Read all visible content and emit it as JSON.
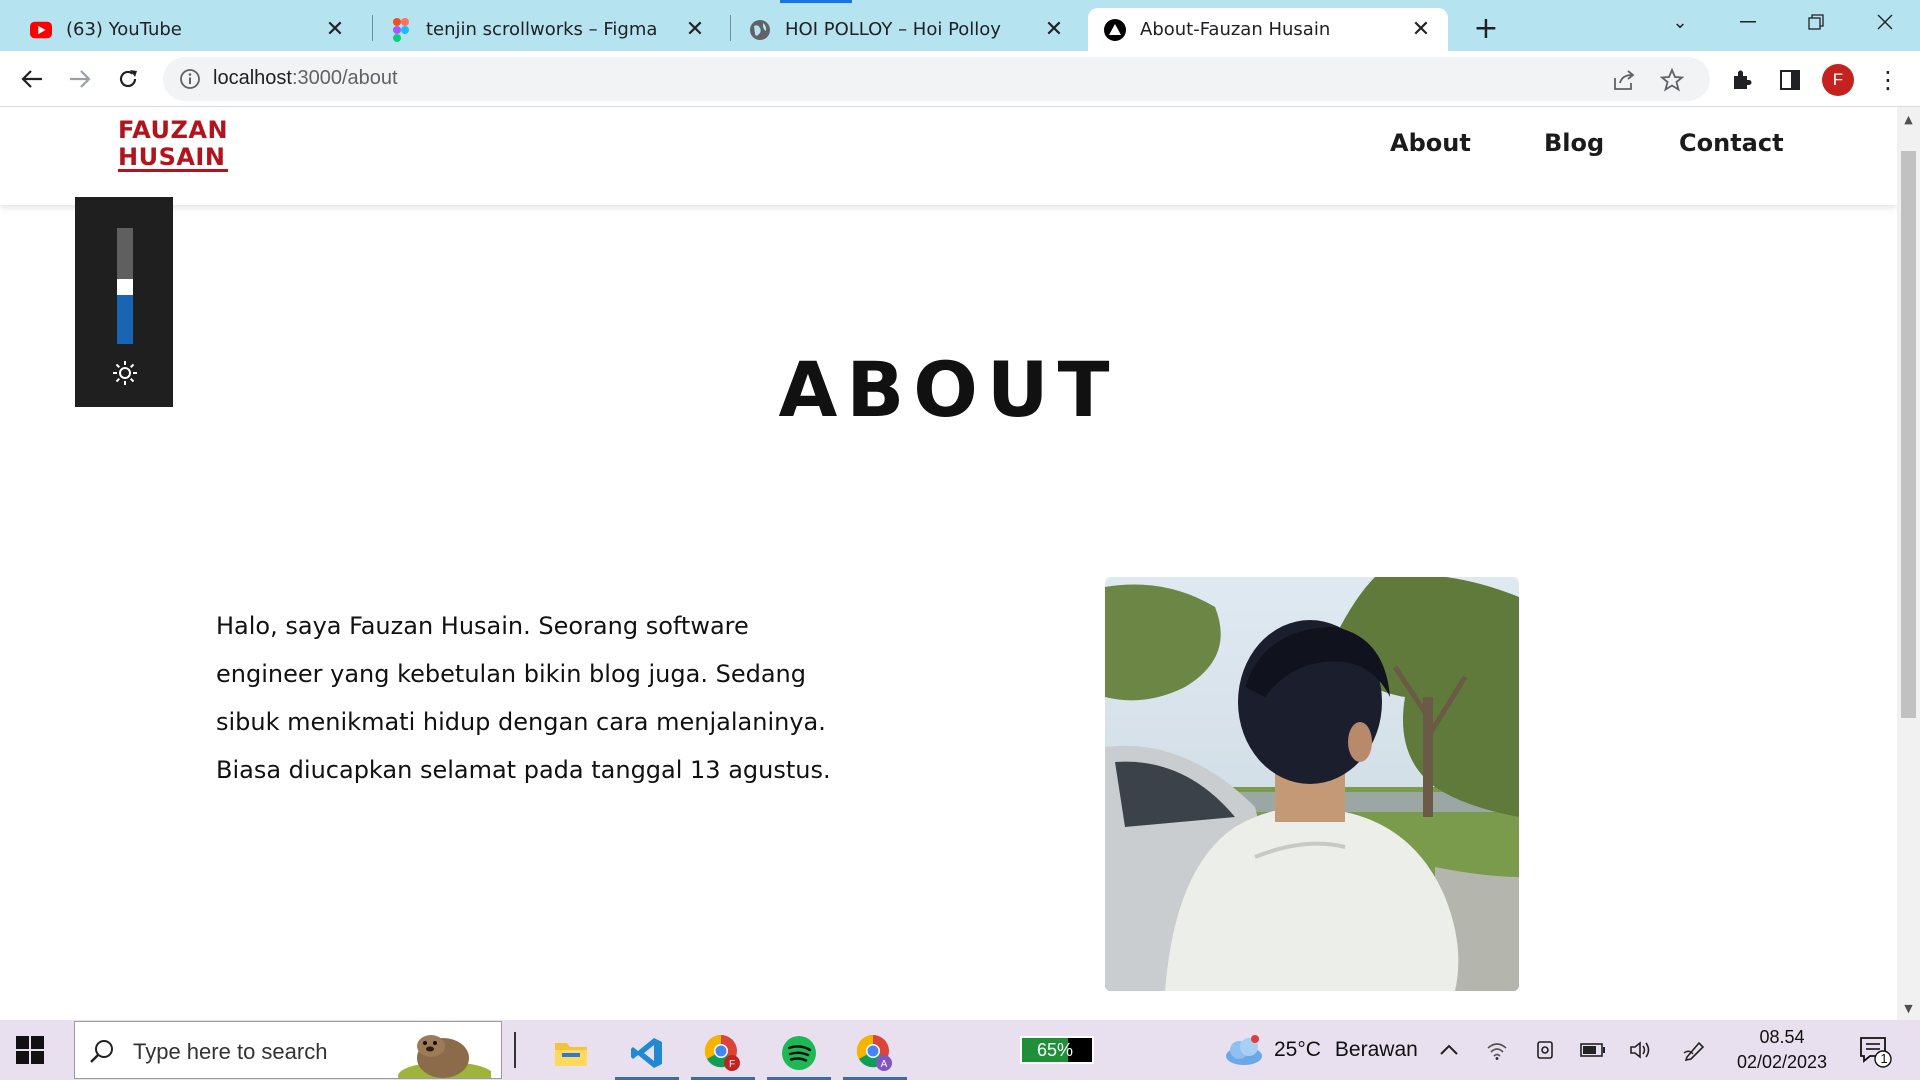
{
  "browser": {
    "tabs": [
      {
        "title": "(63) YouTube",
        "icon": "youtube-icon"
      },
      {
        "title": "tenjin scrollworks – Figma",
        "icon": "figma-icon"
      },
      {
        "title": "HOI POLLOY – Hoi Polloy",
        "icon": "globe-icon"
      },
      {
        "title": "About-Fauzan Husain",
        "icon": "triangle-logo-icon"
      }
    ],
    "url_host": "localhost",
    "url_path": ":3000/about",
    "profile_initial": "F"
  },
  "site": {
    "logo_line1": "FAUZAN",
    "logo_line2": "HUSAIN",
    "nav": [
      "About",
      "Blog",
      "Contact"
    ],
    "title": "ABOUT",
    "bio": "Halo, saya Fauzan Husain. Seorang software engineer yang kebetulan bikin blog juga. Sedang sibuk menikmati hidup dengan cara menjalaninya. Biasa diucapkan selamat pada tanggal 13 agustus.",
    "accent_color": "#b3131d"
  },
  "brightness": {
    "level_percent": 50
  },
  "taskbar": {
    "search_placeholder": "Type here to search",
    "battery_percent": "65%",
    "temperature": "25°C",
    "weather_text": "Berawan",
    "time": "08.54",
    "date": "02/02/2023",
    "notification_count": "1"
  }
}
